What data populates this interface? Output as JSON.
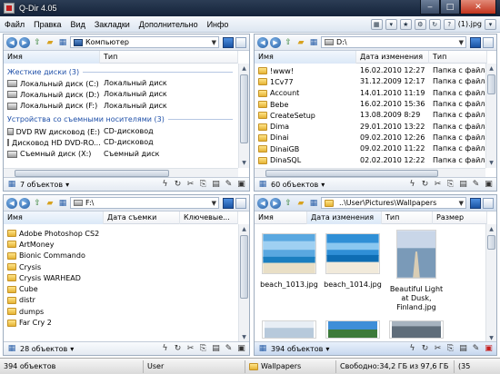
{
  "window": {
    "title": "Q-Dir 4.05"
  },
  "menu": {
    "items": [
      "Файл",
      "Правка",
      "Вид",
      "Закладки",
      "Дополнительно",
      "Инфо"
    ],
    "right_file": "(1).jpg"
  },
  "panes": {
    "tl": {
      "address": "Компьютер",
      "columns": [
        "Имя",
        "Тип"
      ],
      "groups": [
        {
          "title": "Жесткие диски (3)",
          "rows": [
            {
              "name": "Локальный диск (C:)",
              "type": "Локальный диск"
            },
            {
              "name": "Локальный диск (D:)",
              "type": "Локальный диск"
            },
            {
              "name": "Локальный диск (F:)",
              "type": "Локальный диск"
            }
          ]
        },
        {
          "title": "Устройства со съемными носителями (3)",
          "rows": [
            {
              "name": "DVD RW дисковод (E:)",
              "type": "CD-дисковод"
            },
            {
              "name": "Дисковод HD DVD-RO...",
              "type": "CD-дисковод"
            },
            {
              "name": "Съемный диск (X:)",
              "type": "Съемный диск"
            }
          ]
        }
      ],
      "status": "7 объектов"
    },
    "tr": {
      "address": "D:\\",
      "columns": [
        "Имя",
        "Дата изменения",
        "Тип"
      ],
      "rows": [
        {
          "name": "!www!",
          "date": "16.02.2010 12:27",
          "type": "Папка с файлам"
        },
        {
          "name": "1Cv77",
          "date": "31.12.2009 12:17",
          "type": "Папка с файлам"
        },
        {
          "name": "Account",
          "date": "14.01.2010 11:19",
          "type": "Папка с файлам"
        },
        {
          "name": "Bebe",
          "date": "16.02.2010 15:36",
          "type": "Папка с файлам"
        },
        {
          "name": "CreateSetup",
          "date": "13.08.2009 8:29",
          "type": "Папка с файлам"
        },
        {
          "name": "Dima",
          "date": "29.01.2010 13:22",
          "type": "Папка с файлам"
        },
        {
          "name": "Dinai",
          "date": "09.02.2010 12:26",
          "type": "Папка с файлам"
        },
        {
          "name": "DinaiGB",
          "date": "09.02.2010 11:22",
          "type": "Папка с файлам"
        },
        {
          "name": "DinaSQL",
          "date": "02.02.2010 12:22",
          "type": "Папка с файлам"
        }
      ],
      "status": "60 объектов"
    },
    "bl": {
      "address": "F:\\",
      "columns": [
        "Имя",
        "Дата съемки",
        "Ключевые..."
      ],
      "rows": [
        "Adobe Photoshop CS2",
        "ArtMoney",
        "Bionic Commando",
        "Crysis",
        "Crysis WARHEAD",
        "Cube",
        "distr",
        "dumps",
        "Far Cry 2"
      ],
      "status": "28 объектов"
    },
    "br": {
      "address": "..\\User\\Pictures\\Wallpapers",
      "columns": [
        "Имя",
        "Дата изменения",
        "Тип",
        "Размер"
      ],
      "thumbs": [
        {
          "label": "beach_1013.jpg"
        },
        {
          "label": "beach_1014.jpg"
        },
        {
          "label": "Beautiful Light at Dusk, Finland.jpg"
        }
      ],
      "status": "394 объектов"
    }
  },
  "bottom": {
    "count": "394 объектов",
    "user": "User",
    "folder": "Wallpapers",
    "free": "Свободно:34,2 ГБ из 97,6 ГБ",
    "percent": "(35"
  },
  "colors": {
    "group_text": "#1e4fa8",
    "title_bar": "#1c2c44",
    "active_pane": "#c7d8ef"
  }
}
